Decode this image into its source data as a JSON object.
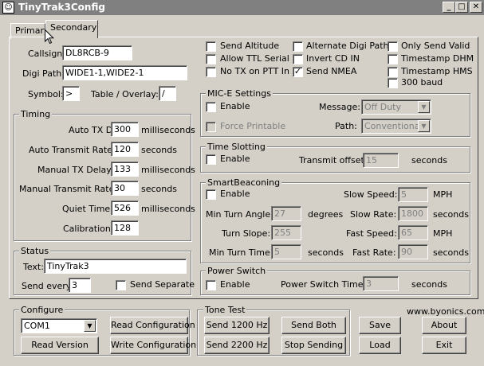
{
  "window": {
    "title": "TinyTrak3Config",
    "icon_glyph": "☺",
    "controls": [
      "_",
      "□",
      "✕"
    ]
  },
  "tabs": [
    {
      "label": "Primary"
    },
    {
      "label": "Secondary"
    }
  ],
  "station": {
    "callsign_label": "Callsign:",
    "callsign_value": "DL8RCB-9",
    "digipath_label": "Digi Path:",
    "digipath_value": "WIDE1-1,WIDE2-1",
    "symbol_label": "Symbol:",
    "symbol_value": ">",
    "table_label": "Table / Overlay:",
    "table_value": "/"
  },
  "options": [
    {
      "label": "Send Altitude",
      "checked": false
    },
    {
      "label": "Alternate Digi Paths",
      "checked": false
    },
    {
      "label": "Only Send Valid",
      "checked": false
    },
    {
      "label": "Allow TTL Serial",
      "checked": false
    },
    {
      "label": "Invert CD IN",
      "checked": false
    },
    {
      "label": "Timestamp DHM",
      "checked": false
    },
    {
      "label": "No TX on PTT In",
      "checked": false
    },
    {
      "label": "Send NMEA",
      "checked": true
    },
    {
      "label": "Timestamp HMS",
      "checked": false
    },
    {
      "label": "300 baud",
      "checked": false
    }
  ],
  "check_glyph": "✓",
  "timing": {
    "title": "Timing",
    "rows": [
      {
        "label": "Auto TX Delay:",
        "value": "300",
        "unit": "milliseconds"
      },
      {
        "label": "Auto Transmit Rate:",
        "value": "120",
        "unit": "seconds"
      },
      {
        "label": "Manual TX Delay:",
        "value": "133",
        "unit": "milliseconds"
      },
      {
        "label": "Manual Transmit Rate:",
        "value": "30",
        "unit": "seconds"
      },
      {
        "label": "Quiet Time:",
        "value": "526",
        "unit": "milliseconds"
      },
      {
        "label": "Calibration:",
        "value": "128",
        "unit": ""
      }
    ]
  },
  "status": {
    "title": "Status",
    "text_label": "Text:",
    "text_value": "TinyTrak3",
    "send_every_label": "Send every:",
    "send_every_value": "3",
    "send_separate_label": "Send Separate"
  },
  "mice": {
    "title": "MIC-E Settings",
    "enable_label": "Enable",
    "message_label": "Message:",
    "message_value": "Off Duty",
    "force_label": "Force Printable",
    "path_label": "Path:",
    "path_value": "Conventional"
  },
  "timeslot": {
    "title": "Time Slotting",
    "enable_label": "Enable",
    "offset_label": "Transmit offset:",
    "offset_value": "15",
    "unit": "seconds"
  },
  "smartbeacon": {
    "title": "SmartBeaconing",
    "enable_label": "Enable",
    "slow_speed_label": "Slow Speed:",
    "slow_speed_value": "5",
    "slow_speed_unit": "MPH",
    "min_turn_angle_label": "Min Turn Angle:",
    "min_turn_angle_value": "27",
    "min_turn_angle_unit": "degrees",
    "slow_rate_label": "Slow Rate:",
    "slow_rate_value": "1800",
    "slow_rate_unit": "seconds",
    "turn_slope_label": "Turn Slope:",
    "turn_slope_value": "255",
    "fast_speed_label": "Fast Speed:",
    "fast_speed_value": "65",
    "fast_speed_unit": "MPH",
    "min_turn_time_label": "Min Turn Time:",
    "min_turn_time_value": "5",
    "min_turn_time_unit": "seconds",
    "fast_rate_label": "Fast Rate:",
    "fast_rate_value": "90",
    "fast_rate_unit": "seconds"
  },
  "powerswitch": {
    "title": "Power Switch",
    "enable_label": "Enable",
    "time_label": "Power Switch Time:",
    "time_value": "3",
    "unit": "seconds"
  },
  "configure": {
    "title": "Configure",
    "port_value": "COM1",
    "read_config": "Read Configuration",
    "read_version": "Read Version",
    "write_config": "Write Configuration"
  },
  "tonetest": {
    "title": "Tone Test",
    "send1200": "Send 1200 Hz",
    "send_both": "Send Both",
    "send2200": "Send 2200 Hz",
    "stop": "Stop Sending"
  },
  "footer": {
    "website": "www.byonics.com",
    "save": "Save",
    "about": "About",
    "load": "Load",
    "exit": "Exit"
  },
  "dropdown_arrow": "▼"
}
